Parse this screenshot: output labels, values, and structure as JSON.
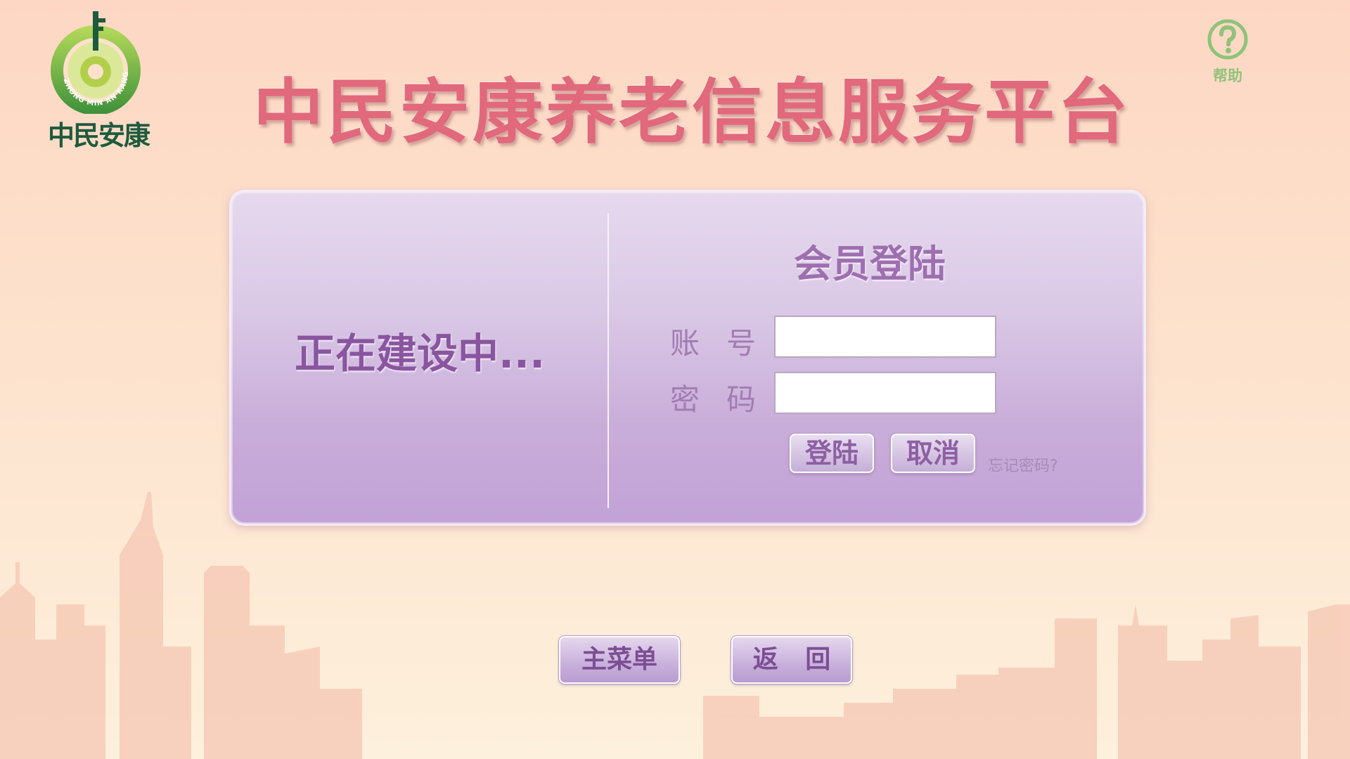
{
  "header": {
    "logo_text": "中民安康",
    "logo_ring_text": "ZHONG MIN AN KANG",
    "title": "中民安康养老信息服务平台",
    "help_label": "帮助"
  },
  "panel": {
    "left_status": "正在建设中...",
    "login_title": "会员登陆",
    "account_label": "账号",
    "account_value": "",
    "password_label": "密码",
    "password_value": "",
    "login_button": "登陆",
    "cancel_button": "取消",
    "forgot_link": "忘记密码?"
  },
  "footer": {
    "main_menu_button": "主菜单",
    "back_button": "返 回"
  },
  "colors": {
    "title": "#e2687c",
    "accent_purple": "#8a55a0",
    "logo_green": "#8fc37a",
    "logo_dark_green": "#1e5a3e"
  }
}
